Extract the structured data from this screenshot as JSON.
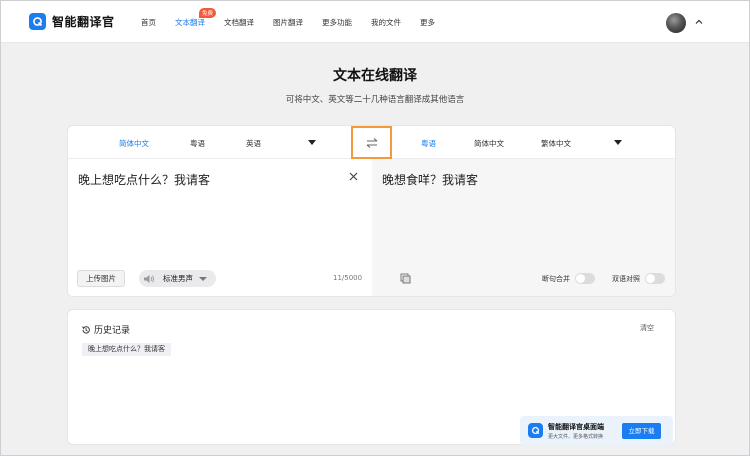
{
  "brand": {
    "name": "智能翻译官"
  },
  "nav": {
    "items": [
      {
        "label": "首页"
      },
      {
        "label": "文本翻译",
        "badge": "免费"
      },
      {
        "label": "文档翻译"
      },
      {
        "label": "图片翻译"
      },
      {
        "label": "更多功能"
      },
      {
        "label": "我的文件"
      },
      {
        "label": "更多"
      }
    ],
    "active_index": 1
  },
  "page": {
    "title": "文本在线翻译",
    "subtitle": "可将中文、英文等二十几种语言翻译成其他语言"
  },
  "translator": {
    "source_langs": [
      "简体中文",
      "粤语",
      "英语"
    ],
    "source_active": "简体中文",
    "target_langs": [
      "粤语",
      "简体中文",
      "繁体中文"
    ],
    "target_active": "粤语",
    "source_text": "晚上想吃点什么？我请客",
    "target_text": "晚想食咩？我请客",
    "upload_label": "上传图片",
    "voice_label": "标准男声",
    "char_count": "11/5000",
    "toggle_sentence_merge": "断句合并",
    "toggle_bilingual": "双语对照"
  },
  "history": {
    "title": "历史记录",
    "clear_label": "清空",
    "items": [
      "晚上想吃点什么？我请客"
    ]
  },
  "promo": {
    "title": "智能翻译官桌面端",
    "subtitle": "更大文件、更多格式转换",
    "button": "立即下载"
  },
  "colors": {
    "accent": "#1a7df2",
    "highlight": "#f39a3d",
    "badge": "#f25a3c"
  }
}
